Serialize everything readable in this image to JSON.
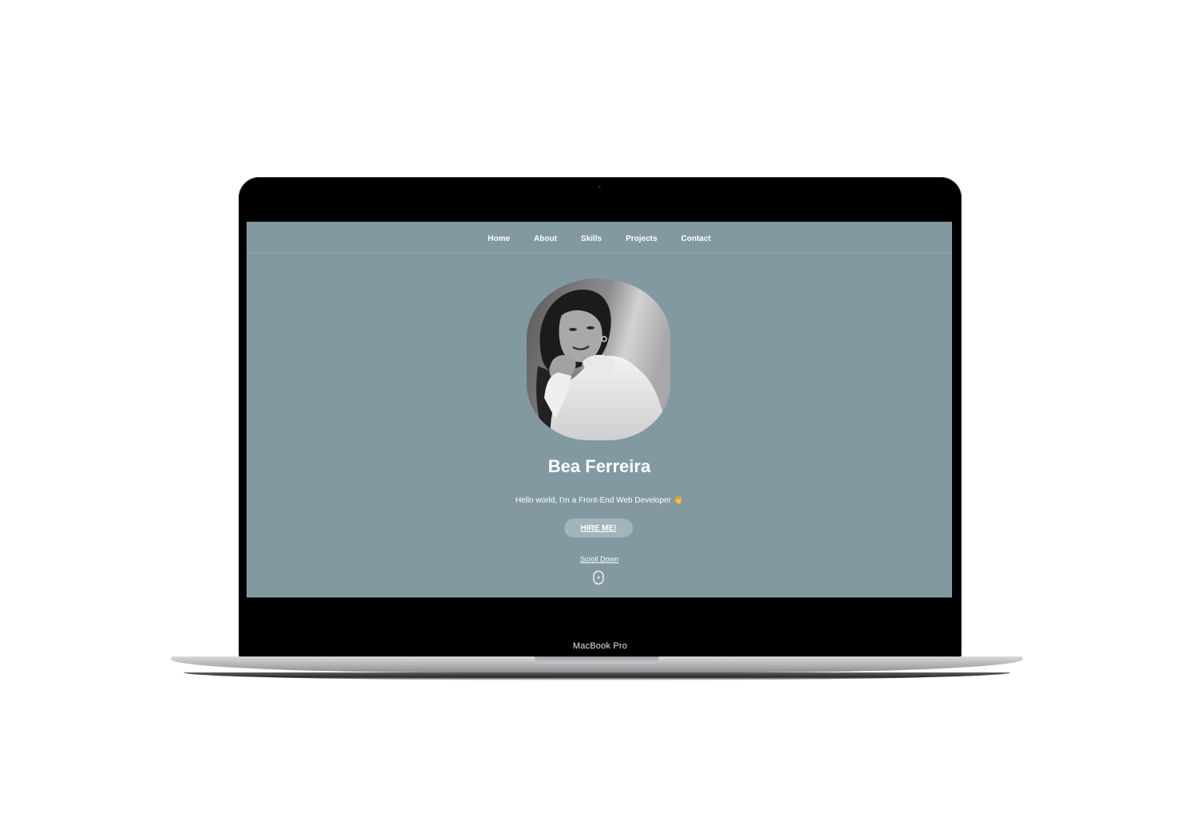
{
  "device": {
    "label": "MacBook Pro"
  },
  "nav": {
    "items": [
      {
        "label": "Home"
      },
      {
        "label": "About"
      },
      {
        "label": "Skills"
      },
      {
        "label": "Projects"
      },
      {
        "label": "Contact"
      }
    ]
  },
  "hero": {
    "name": "Bea Ferreira",
    "tagline": "Hello world, I'm a Front-End Web Developer 👋",
    "hire_button": "HIRE ME!",
    "scroll_label": "Scroll Down",
    "scroll_icon": "mouse-icon",
    "portrait_alt": "portrait-photo"
  },
  "colors": {
    "page_background": "#8299a2",
    "button_background": "#a3b4bb",
    "text": "#ffffff",
    "bezel": "#000000"
  }
}
